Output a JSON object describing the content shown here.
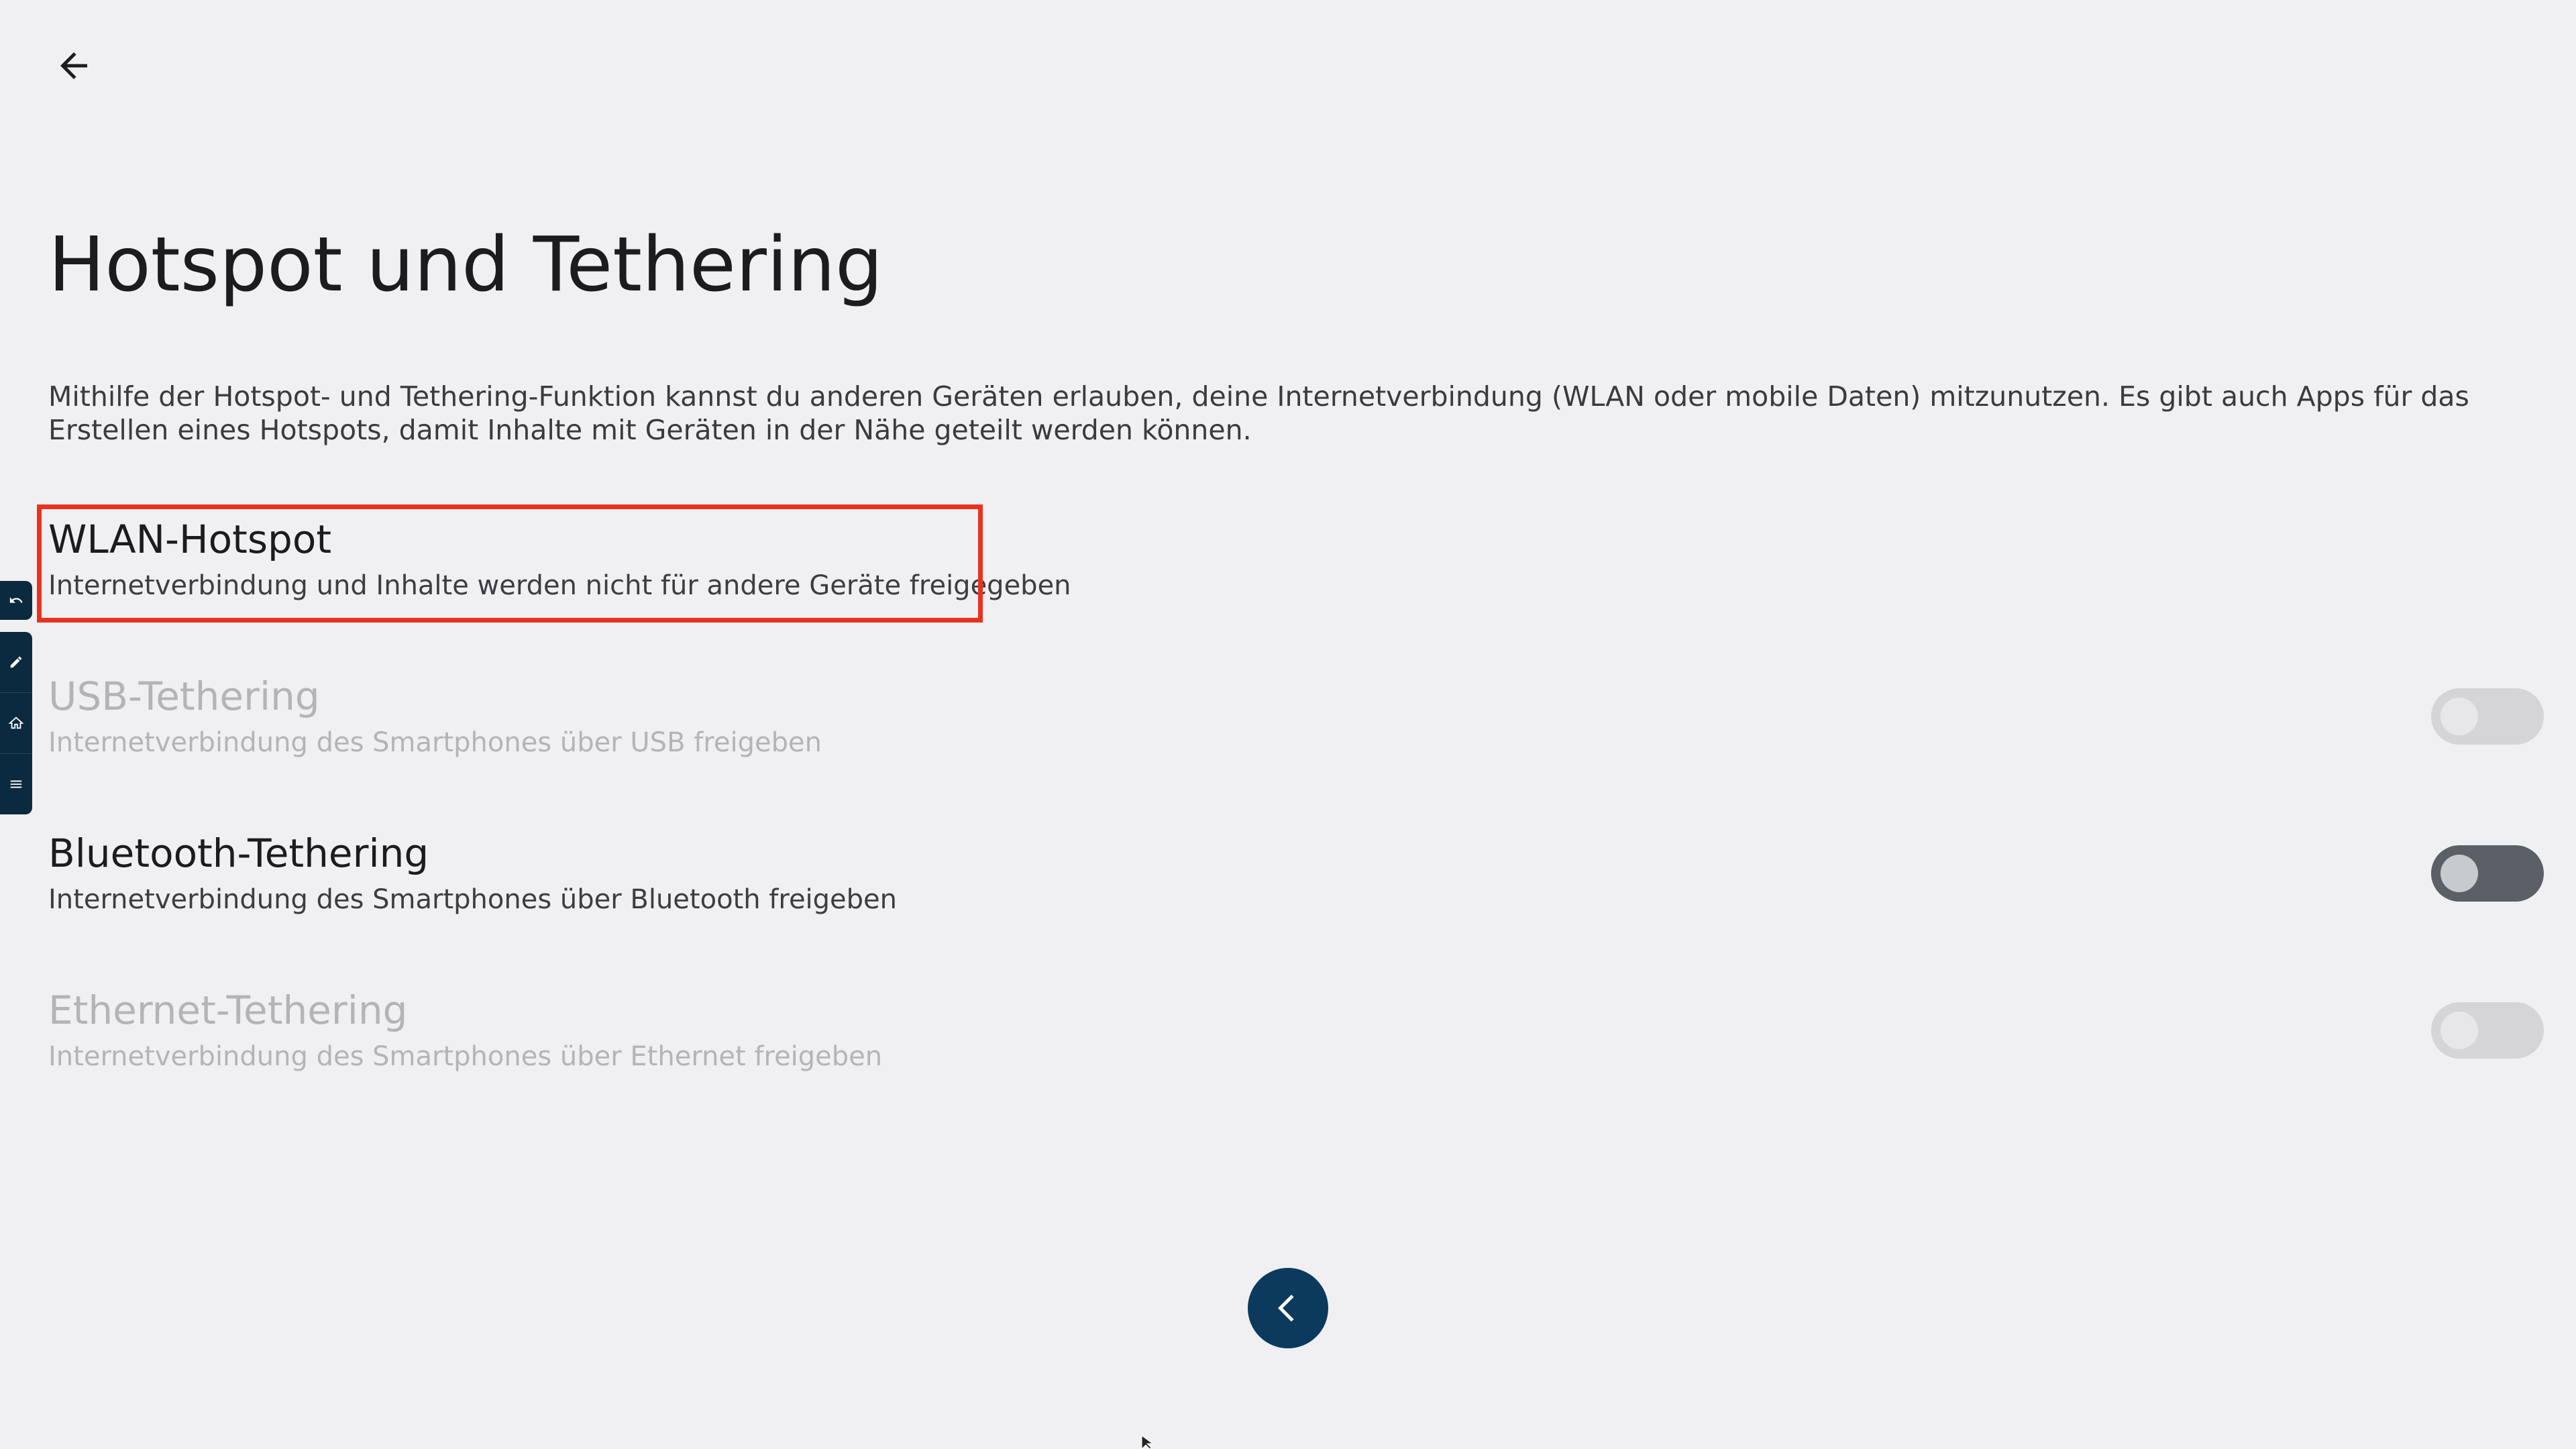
{
  "header": {
    "back_icon": "arrow-left-icon"
  },
  "page": {
    "title": "Hotspot und Tethering",
    "description": "Mithilfe der Hotspot- und Tethering-Funktion kannst du anderen Geräten erlauben, deine Internetverbindung (WLAN oder mobile Daten) mitzunutzen. Es gibt auch Apps für das Erstellen eines Hotspots, damit Inhalte mit Geräten in der Nähe geteilt werden können."
  },
  "settings": [
    {
      "title": "WLAN-Hotspot",
      "summary": "Internetverbindung und Inhalte werden nicht für andere Geräte freigegeben",
      "enabled": true,
      "has_toggle": false,
      "highlighted": true
    },
    {
      "title": "USB-Tethering",
      "summary": "Internetverbindung des Smartphones über USB freigeben",
      "enabled": false,
      "has_toggle": true,
      "checked": false
    },
    {
      "title": "Bluetooth-Tethering",
      "summary": "Internetverbindung des Smartphones über Bluetooth freigeben",
      "enabled": true,
      "has_toggle": true,
      "checked": false
    },
    {
      "title": "Ethernet-Tethering",
      "summary": "Internetverbindung des Smartphones über Ethernet freigeben",
      "enabled": false,
      "has_toggle": true,
      "checked": false
    }
  ],
  "colors": {
    "background": "#f0f0f2",
    "highlight": "#e8321f",
    "fab": "#0c3a5c",
    "toolbar": "#0b2a3f"
  },
  "floating_button": {
    "icon": "chevron-left-icon"
  },
  "side_toolbar": {
    "icons": [
      "undo-icon",
      "pen-icon",
      "home-icon",
      "menu-icon"
    ]
  }
}
